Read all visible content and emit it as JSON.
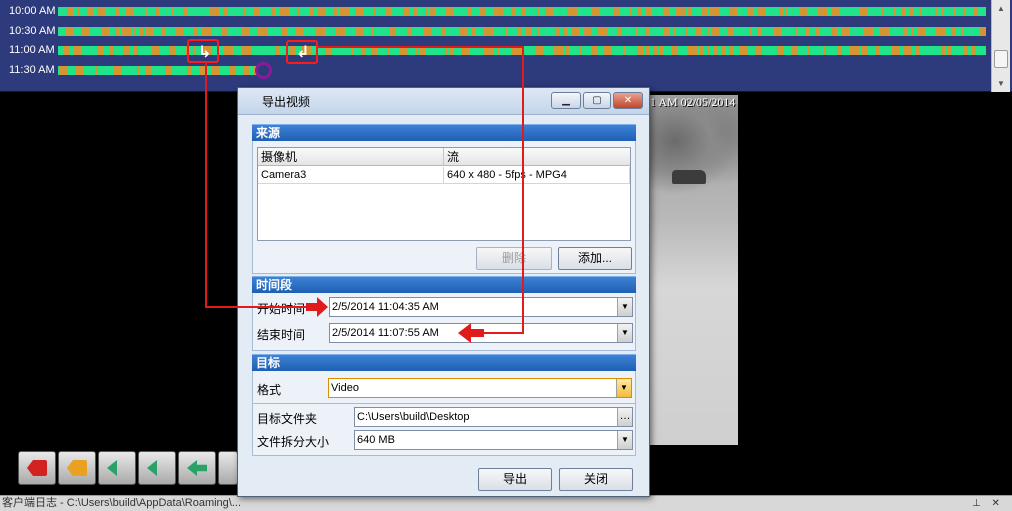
{
  "timeline": {
    "rows": [
      {
        "label": "10:00 AM"
      },
      {
        "label": "10:30 AM"
      },
      {
        "label": "11:00 AM"
      },
      {
        "label": "11:30 AM"
      }
    ]
  },
  "video": {
    "overlay": "1 AM 02/05/2014"
  },
  "dialog": {
    "title": "导出视频",
    "source": {
      "header": "来源",
      "columns": [
        "摄像机",
        "流"
      ],
      "rows": [
        {
          "camera": "Camera3",
          "stream": "640 x 480 - 5fps - MPG4"
        }
      ],
      "delete_label": "删除",
      "add_label": "添加..."
    },
    "period": {
      "header": "时间段",
      "start_label": "开始时间",
      "start_value": "2/5/2014 11:04:35 AM",
      "end_label": "结束时间",
      "end_value": "2/5/2014 11:07:55 AM"
    },
    "target": {
      "header": "目标",
      "format_label": "格式",
      "format_value": "Video",
      "folder_label": "目标文件夹",
      "folder_value": "C:\\Users\\build\\Desktop",
      "split_label": "文件拆分大小",
      "split_value": "640 MB"
    },
    "export_label": "导出",
    "close_label": "关闭"
  },
  "statusbar": {
    "text": "客户端日志 - C:\\Users\\build\\AppData\\Roaming\\..."
  },
  "colors": {
    "timeline_bg": "#2d3a7c",
    "recording_green": "#20e38a",
    "motion_orange": "#d49633",
    "section_blue": "#1f5fb3",
    "annotation_red": "#e01b1b"
  }
}
